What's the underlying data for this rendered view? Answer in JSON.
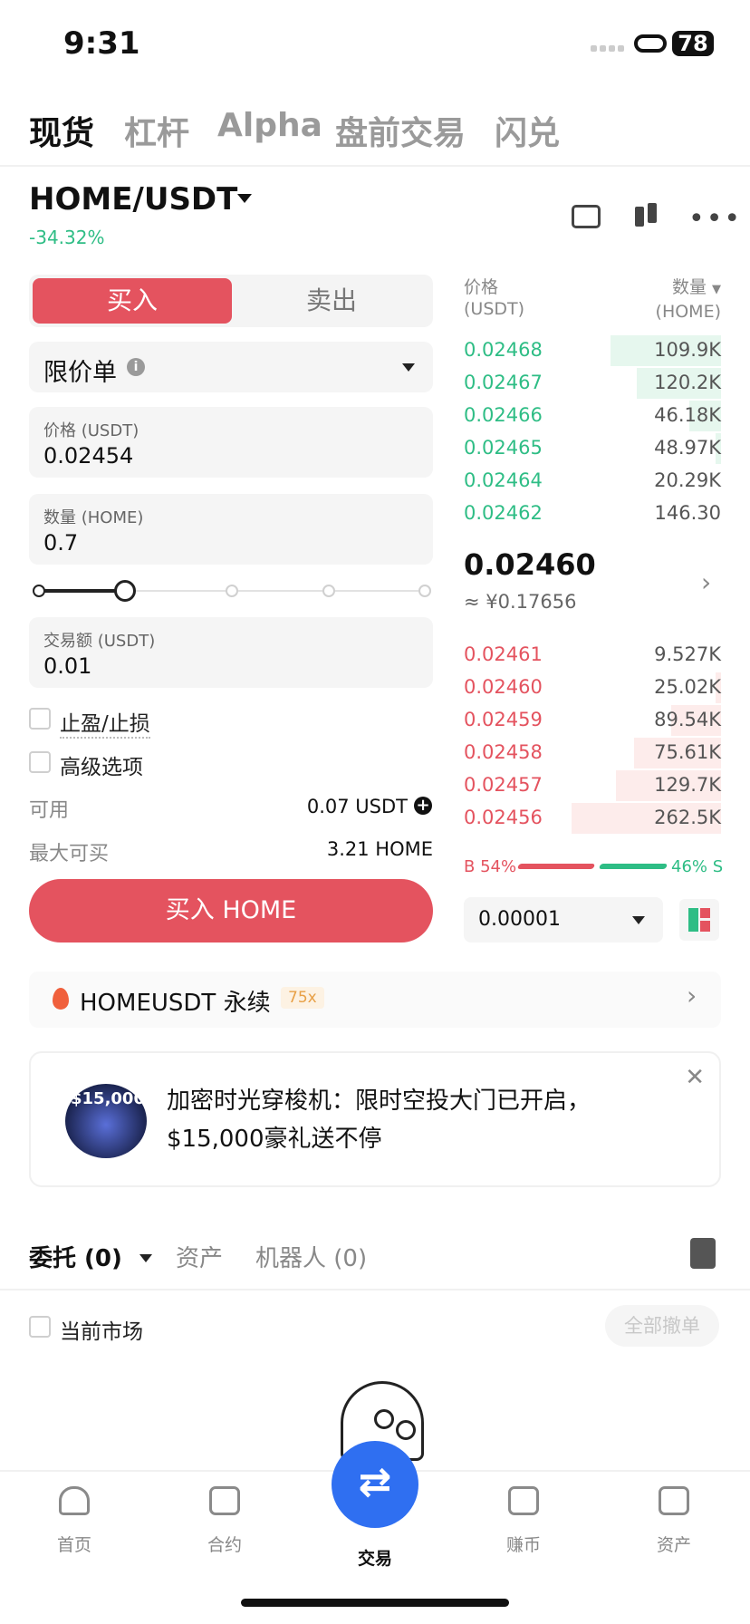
{
  "status": {
    "time": "9:31",
    "battery": "78"
  },
  "top_tabs": [
    "现货",
    "杠杆",
    "Alpha",
    "盘前交易",
    "闪兑"
  ],
  "pair": {
    "name": "HOME/USDT",
    "change": "-34.32%"
  },
  "trade_form": {
    "buy_label": "买入",
    "sell_label": "卖出",
    "order_type": "限价单",
    "price_label": "价格 (USDT)",
    "price_value": "0.02454",
    "qty_label": "数量 (HOME)",
    "qty_value": "0.7",
    "slider_percent": 20,
    "amount_label": "交易额 (USDT)",
    "amount_value": "0.01",
    "tp_sl_label": "止盈/止损",
    "advanced_label": "高级选项",
    "available_label": "可用",
    "available_value": "0.07 USDT",
    "max_buy_label": "最大可买",
    "max_buy_value": "3.21 HOME",
    "submit_label": "买入 HOME"
  },
  "order_book": {
    "price_header": "价格",
    "price_unit": "(USDT)",
    "qty_header": "数量",
    "qty_unit": "(HOME)",
    "asks": [
      {
        "price": "0.02468",
        "qty": "109.9K",
        "depth": 0.42
      },
      {
        "price": "0.02467",
        "qty": "120.2K",
        "depth": 0.32
      },
      {
        "price": "0.02466",
        "qty": "46.18K",
        "depth": 0.12
      },
      {
        "price": "0.02465",
        "qty": "48.97K",
        "depth": 0.02
      },
      {
        "price": "0.02464",
        "qty": "20.29K",
        "depth": 0.0
      },
      {
        "price": "0.02462",
        "qty": "146.30",
        "depth": 0.0
      }
    ],
    "mid_price": "0.02460",
    "mid_cny": "≈ ¥0.17656",
    "bids": [
      {
        "price": "0.02461",
        "qty": "9.527K",
        "depth": 0.0
      },
      {
        "price": "0.02460",
        "qty": "25.02K",
        "depth": 0.02
      },
      {
        "price": "0.02459",
        "qty": "89.54K",
        "depth": 0.19
      },
      {
        "price": "0.02458",
        "qty": "75.61K",
        "depth": 0.33
      },
      {
        "price": "0.02457",
        "qty": "129.7K",
        "depth": 0.4
      },
      {
        "price": "0.02456",
        "qty": "262.5K",
        "depth": 0.57
      }
    ],
    "buy_ratio": "B 54%",
    "sell_ratio": "46% S",
    "precision": "0.00001"
  },
  "perp_banner": {
    "title": "HOMEUSDT 永续",
    "leverage": "75x"
  },
  "ad": {
    "badge": "$15,000",
    "line1": "加密时光穿梭机：限时空投大门已开启，",
    "line2": "$15,000豪礼送不停"
  },
  "orders": {
    "tab_orders": "委托 (0)",
    "tab_assets": "资产",
    "tab_bots": "机器人 (0)",
    "current_market": "当前市场",
    "cancel_all": "全部撤单"
  },
  "bottom_nav": [
    "首页",
    "合约",
    "交易",
    "赚币",
    "资产"
  ],
  "colors": {
    "buy": "#e4535f",
    "sell": "#2ebd85",
    "fab": "#2f6ff1"
  }
}
